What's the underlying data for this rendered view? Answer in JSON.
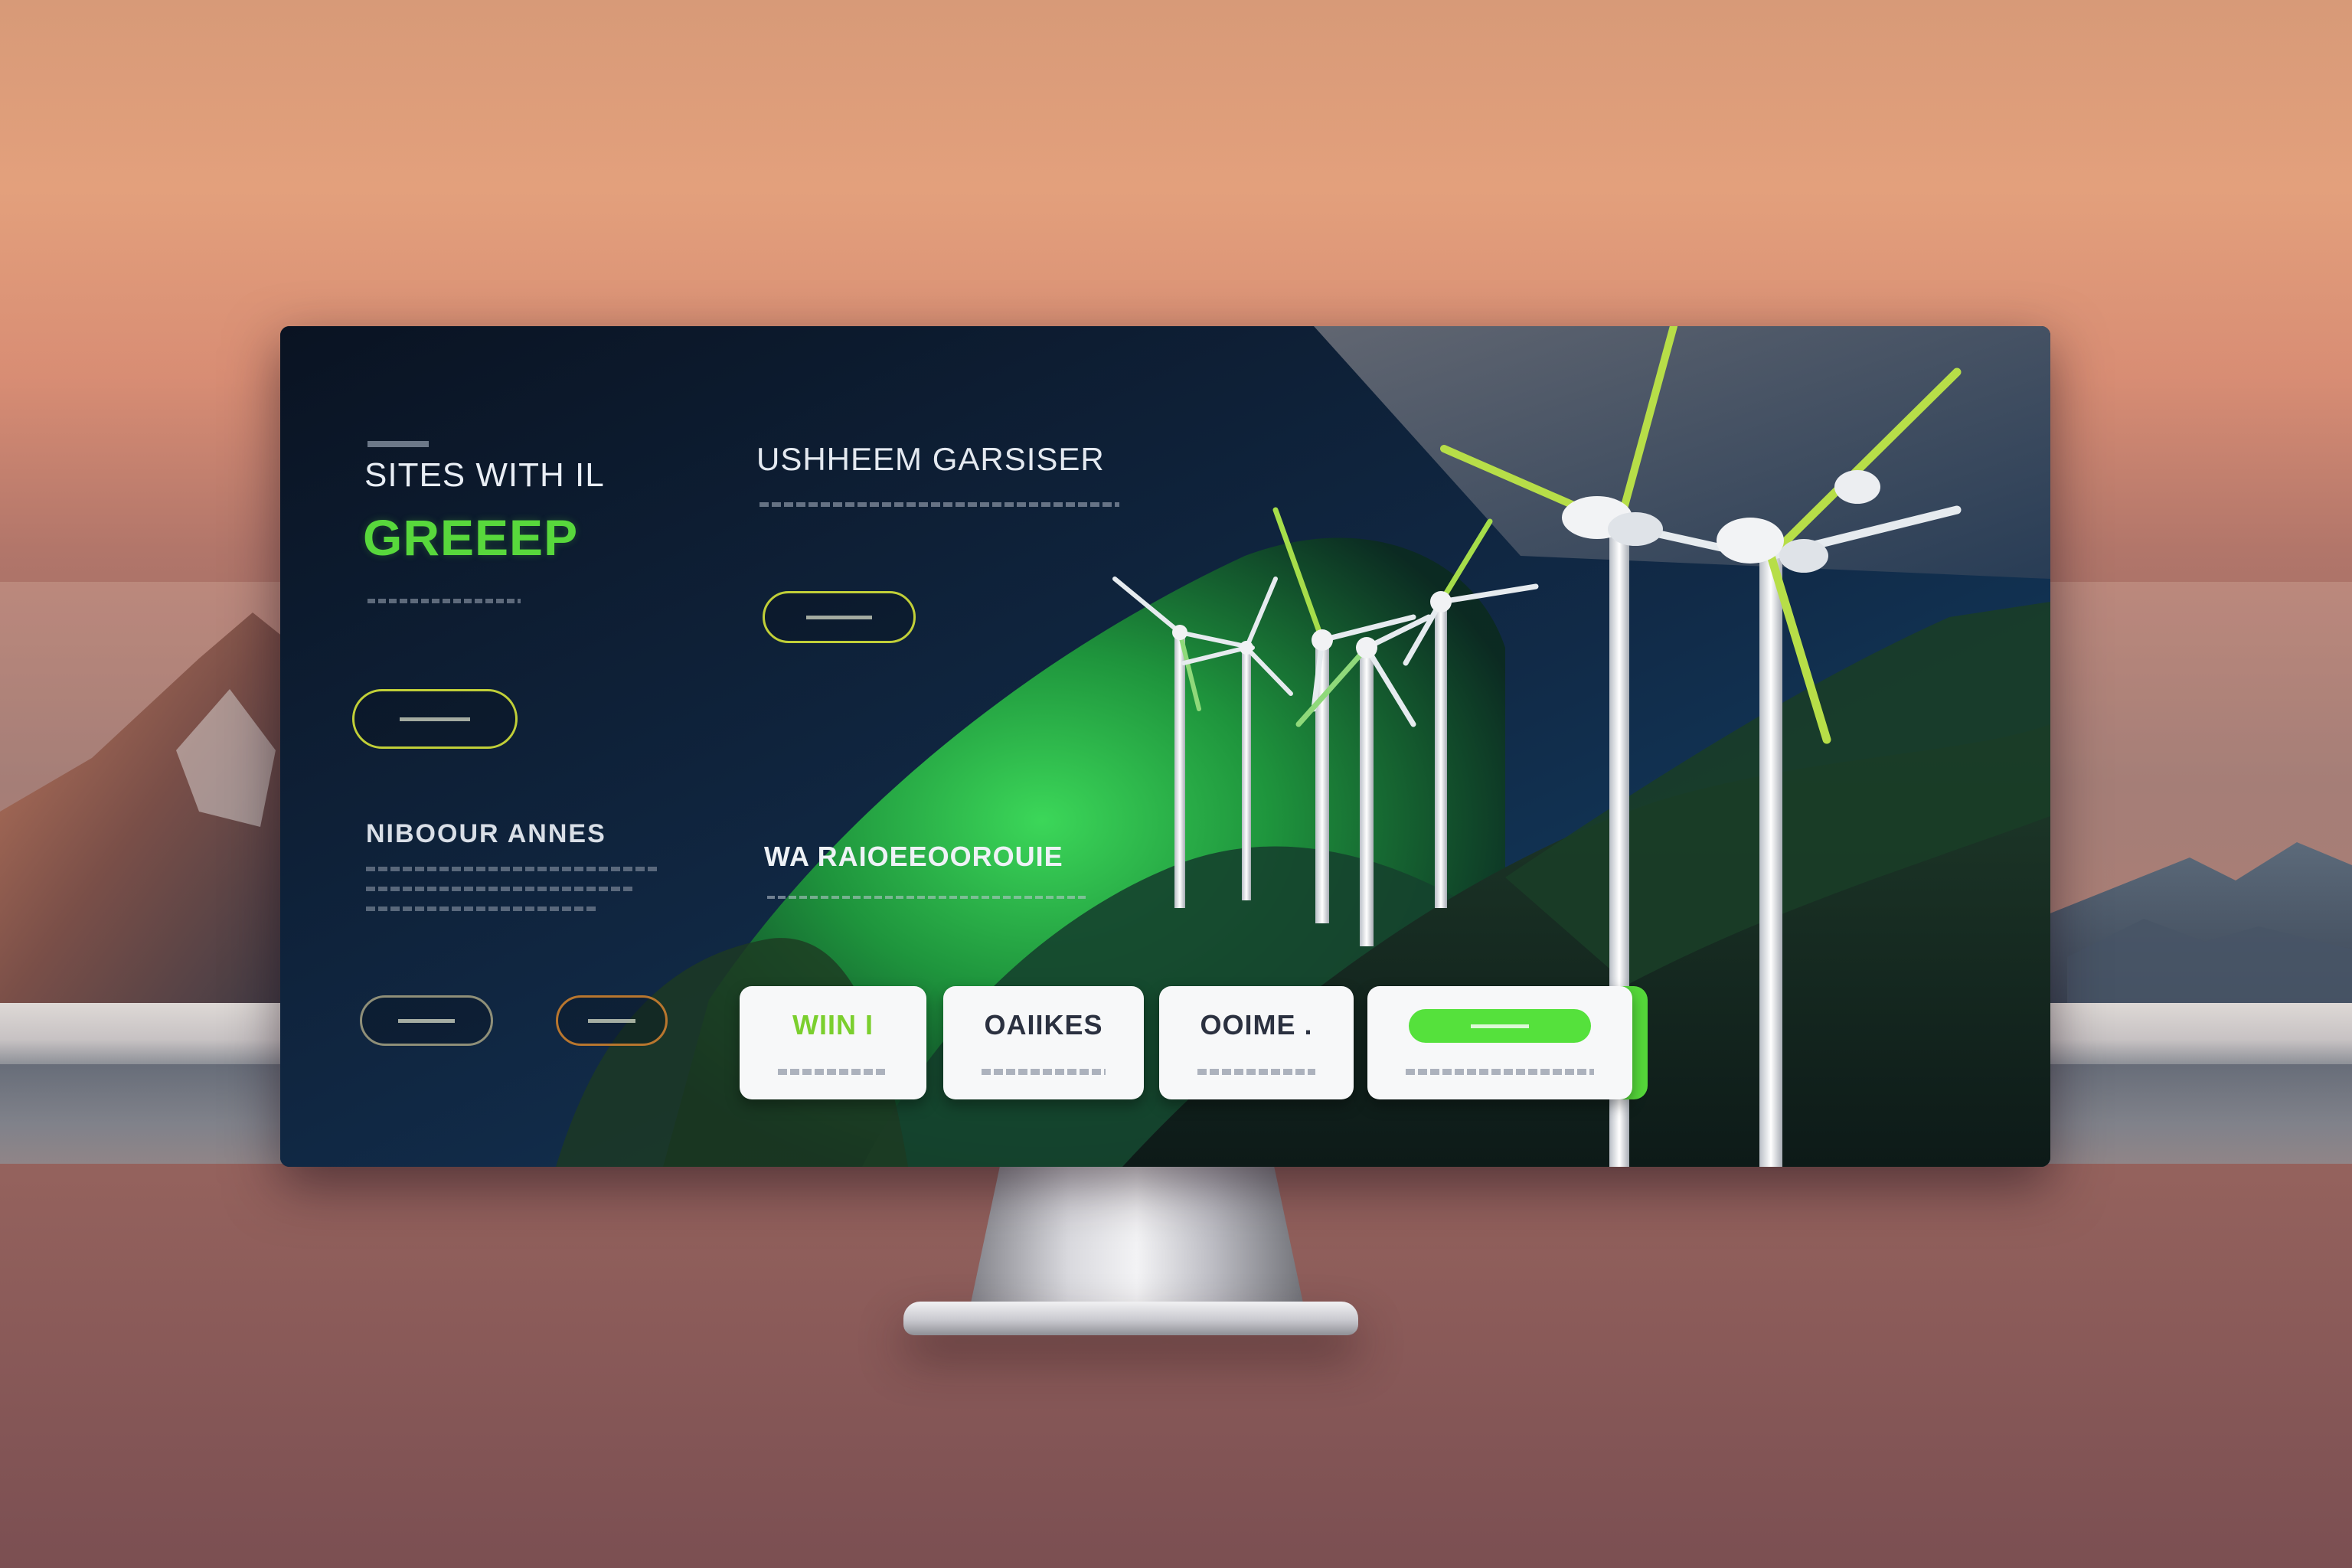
{
  "hero": {
    "line1": "SITES WITH IL",
    "line2": "GREEEP"
  },
  "left_section": {
    "title": "NIBOOUR ANNES"
  },
  "center": {
    "title": "USHHEEM GARSISER",
    "title2": "WA RAIOEEOOROUIE"
  },
  "cards": [
    {
      "label": "WIIN I"
    },
    {
      "label": "OAIIKES"
    },
    {
      "label": "OOIME ."
    },
    {
      "label": ""
    }
  ],
  "colors": {
    "accent_green": "#55e13c",
    "button_border": "#c1cf38",
    "screen_bg": "#0b1524"
  }
}
